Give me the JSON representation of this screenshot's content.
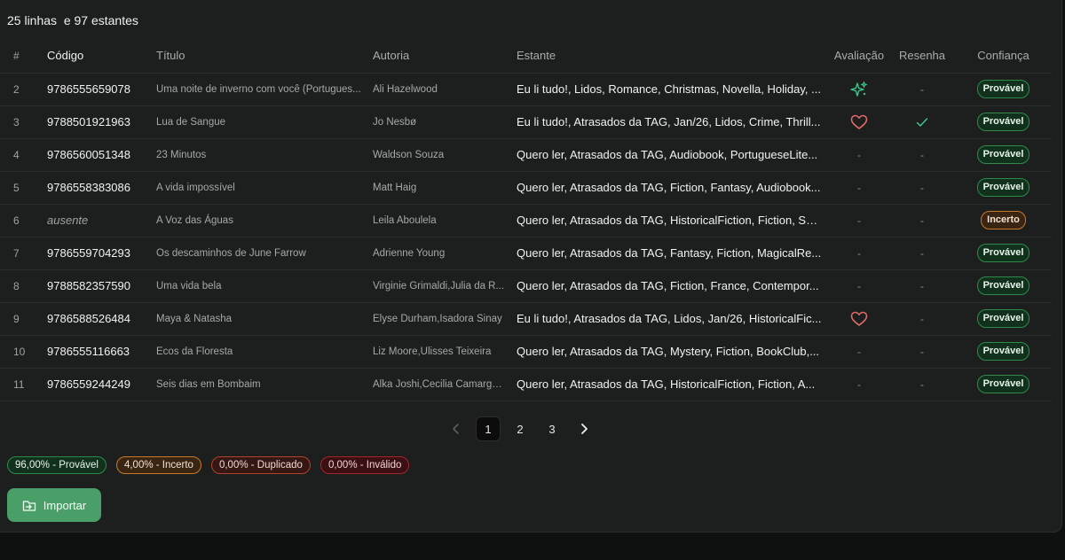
{
  "summary": "25 linhas  e 97 estantes",
  "columns": {
    "num": "#",
    "code": "Código",
    "title": "Título",
    "author": "Autoria",
    "shelf": "Estante",
    "rating": "Avaliação",
    "review": "Resenha",
    "confidence": "Confiança"
  },
  "rows": [
    {
      "num": "2",
      "code": "9786555659078",
      "title": "Uma noite de inverno com você (Portugues...",
      "author": "Ali Hazelwood",
      "shelf": "Eu li tudo!, Lidos, Romance, Christmas, Novella, Holiday, ...",
      "rating_icon": "sparkles-icon",
      "review": "-",
      "confidence": "Provável"
    },
    {
      "num": "3",
      "code": "9788501921963",
      "title": "Lua de Sangue",
      "author": "Jo Nesbø",
      "shelf": "Eu li tudo!, Atrasados da TAG, Jan/26, Lidos, Crime, Thrill...",
      "rating_icon": "heart-icon",
      "review_icon": "check-icon",
      "confidence": "Provável"
    },
    {
      "num": "4",
      "code": "9786560051348",
      "title": "23 Minutos",
      "author": "Waldson Souza",
      "shelf": "Quero ler, Atrasados da TAG, Audiobook, PortugueseLite...",
      "rating": "-",
      "review": "-",
      "confidence": "Provável"
    },
    {
      "num": "5",
      "code": "9786558383086",
      "title": "A vida impossível",
      "author": "Matt Haig",
      "shelf": "Quero ler, Atrasados da TAG, Fiction, Fantasy, Audiobook...",
      "rating": "-",
      "review": "-",
      "confidence": "Provável"
    },
    {
      "num": "6",
      "code": "ausente",
      "title": "A Voz das Águas",
      "author": "Leila Aboulela",
      "shelf": "Quero ler, Atrasados da TAG, HistoricalFiction, Fiction, Su...",
      "rating": "-",
      "review": "-",
      "confidence": "Incerto"
    },
    {
      "num": "7",
      "code": "9786559704293",
      "title": "Os descaminhos de June Farrow",
      "author": "Adrienne Young",
      "shelf": "Quero ler, Atrasados da TAG, Fantasy, Fiction, MagicalRe...",
      "rating": "-",
      "review": "-",
      "confidence": "Provável"
    },
    {
      "num": "8",
      "code": "9788582357590",
      "title": "Uma vida bela",
      "author": "Virginie Grimaldi,Julia da R...",
      "shelf": "Quero ler, Atrasados da TAG, Fiction, France, Contempor...",
      "rating": "-",
      "review": "-",
      "confidence": "Provável"
    },
    {
      "num": "9",
      "code": "9786588526484",
      "title": "Maya & Natasha",
      "author": "Elyse Durham,Isadora Sinay",
      "shelf": "Eu li tudo!, Atrasados da TAG, Lidos, Jan/26, HistoricalFic...",
      "rating_icon": "heart-icon",
      "review": "-",
      "confidence": "Provável"
    },
    {
      "num": "10",
      "code": "9786555116663",
      "title": "Ecos da Floresta",
      "author": "Liz Moore,Ulisses Teixeira",
      "shelf": "Quero ler, Atrasados da TAG, Mystery, Fiction, BookClub,...",
      "rating": "-",
      "review": "-",
      "confidence": "Provável"
    },
    {
      "num": "11",
      "code": "9786559244249",
      "title": "Seis dias em Bombaim",
      "author": "Alka Joshi,Cecilia Camargo ...",
      "shelf": "Quero ler, Atrasados da TAG, HistoricalFiction, Fiction, A...",
      "rating": "-",
      "review": "-",
      "confidence": "Provável"
    }
  ],
  "pagination": {
    "pages": [
      "1",
      "2",
      "3"
    ],
    "current": "1",
    "prev_icon": "chevron-left-icon",
    "next_icon": "chevron-right-icon"
  },
  "stats": [
    {
      "label": "96,00% - Provável",
      "kind": "prov"
    },
    {
      "label": "4,00% - Incerto",
      "kind": "inc"
    },
    {
      "label": "0,00% - Duplicado",
      "kind": "dup"
    },
    {
      "label": "0,00% - Inválido",
      "kind": "inv"
    }
  ],
  "import_button": {
    "label": "Importar",
    "icon": "import-icon"
  },
  "colors": {
    "background": "#1c1f1d",
    "provavel": "#2f8a4a",
    "incerto": "#c47a2a",
    "heart": "#e06a6a",
    "sparkle": "#3fc48a",
    "button": "#4a9e67"
  }
}
